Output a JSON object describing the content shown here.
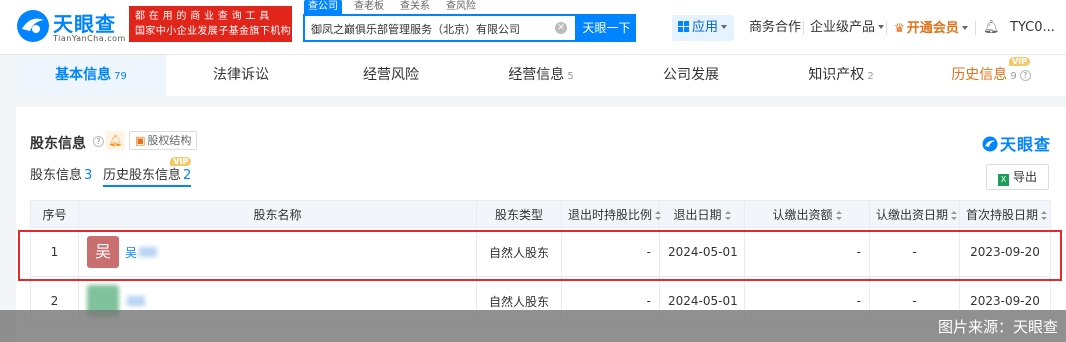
{
  "brand": {
    "name": "天眼查",
    "domain": "TianYanCha.com"
  },
  "slogan": {
    "line1": "都在用的商业查询工具",
    "line2": "国家中小企业发展子基金旗下机构"
  },
  "search": {
    "tabs": [
      "查公司",
      "查老板",
      "查关系",
      "查风险"
    ],
    "value": "御凤之巅俱乐部管理服务（北京）有限公司",
    "button": "天眼一下"
  },
  "nav": {
    "apps": "应用",
    "business": "商务合作",
    "enterprise": "企业级产品",
    "vip": "开通会员",
    "user": "TYC0..."
  },
  "main_tabs": [
    {
      "label": "基本信息",
      "count": "79"
    },
    {
      "label": "法律诉讼",
      "count": ""
    },
    {
      "label": "经营风险",
      "count": ""
    },
    {
      "label": "经营信息",
      "count": "5"
    },
    {
      "label": "公司发展",
      "count": ""
    },
    {
      "label": "知识产权",
      "count": "2"
    },
    {
      "label": "历史信息",
      "count": "9",
      "badge": "VIP"
    }
  ],
  "section": {
    "title": "股东信息",
    "equity_link": "股权结构",
    "brand": "天眼查",
    "export": "导出",
    "subtabs": [
      {
        "label": "股东信息",
        "count": "3"
      },
      {
        "label": "历史股东信息",
        "count": "2",
        "badge": "VIP"
      }
    ]
  },
  "table": {
    "columns": [
      "序号",
      "股东名称",
      "股东类型",
      "退出时持股比例",
      "退出日期",
      "认缴出资额",
      "认缴出资日期",
      "首次持股日期"
    ],
    "rows": [
      {
        "index": "1",
        "avatar": "吴",
        "name": "吴",
        "type": "自然人股东",
        "exit_ratio": "-",
        "exit_date": "2024-05-01",
        "capital": "-",
        "capital_date": "-",
        "first_date": "2023-09-20"
      },
      {
        "index": "2",
        "avatar": "",
        "name": "",
        "type": "自然人股东",
        "exit_ratio": "-",
        "exit_date": "2024-05-01",
        "capital": "-",
        "capital_date": "-",
        "first_date": "2023-09-20"
      }
    ]
  },
  "watermark": "图片来源：天眼查",
  "colors": {
    "accent": "#0084ff",
    "brand_red": "#e1251b",
    "highlight": "#e4282b",
    "vip": "#e5711a"
  }
}
